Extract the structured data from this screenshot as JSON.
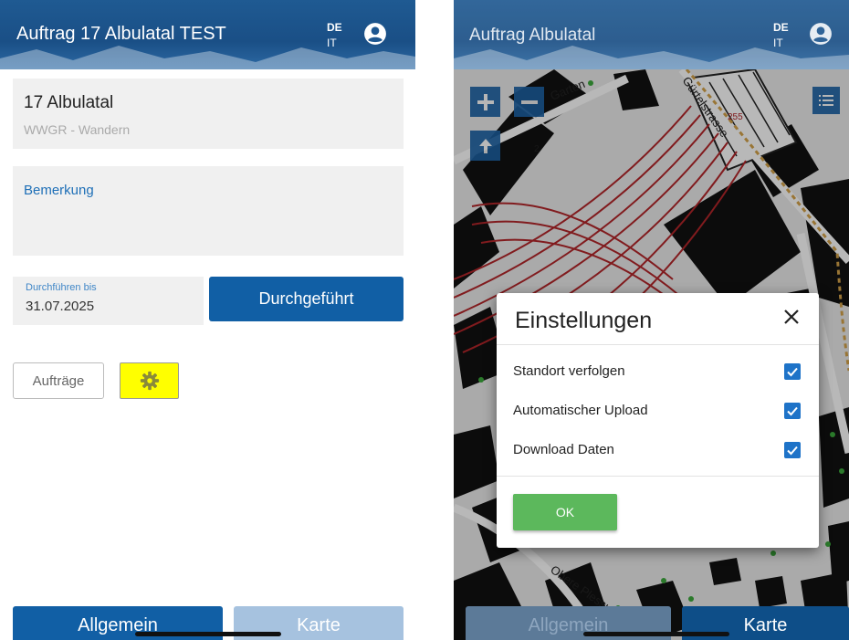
{
  "left": {
    "app_title": "Auftrag 17 Albulatal TEST",
    "lang_primary": "DE",
    "lang_secondary": "IT",
    "order_name": "17 Albulatal",
    "order_subtitle": "WWGR - Wandern",
    "remark_label": "Bemerkung",
    "due_label": "Durchführen bis",
    "due_value": "31.07.2025",
    "done_button": "Durchgeführt",
    "orders_button": "Aufträge",
    "settings_icon": "gear-icon",
    "tab_general": "Allgemein",
    "tab_map": "Karte"
  },
  "right": {
    "app_title": "Auftrag Albulatal",
    "lang_primary": "DE",
    "lang_secondary": "IT",
    "map_labels": {
      "street_garten": "Garten",
      "street_guertel": "Gürtelstrasse",
      "street_plessur": "Obere Plessur",
      "number_255": "255",
      "number_2": "2"
    },
    "dialog": {
      "title": "Einstellungen",
      "options": [
        {
          "label": "Standort verfolgen",
          "checked": true
        },
        {
          "label": "Automatischer Upload",
          "checked": true
        },
        {
          "label": "Download Daten",
          "checked": true
        }
      ],
      "ok_button": "OK"
    },
    "tab_general": "Allgemein",
    "tab_map": "Karte"
  },
  "colors": {
    "primary": "#115fa5",
    "primary_disabled": "#a6c2df",
    "highlight": "#ffff00",
    "ok_green": "#5cb85c",
    "checkbox": "#1e73c8"
  }
}
